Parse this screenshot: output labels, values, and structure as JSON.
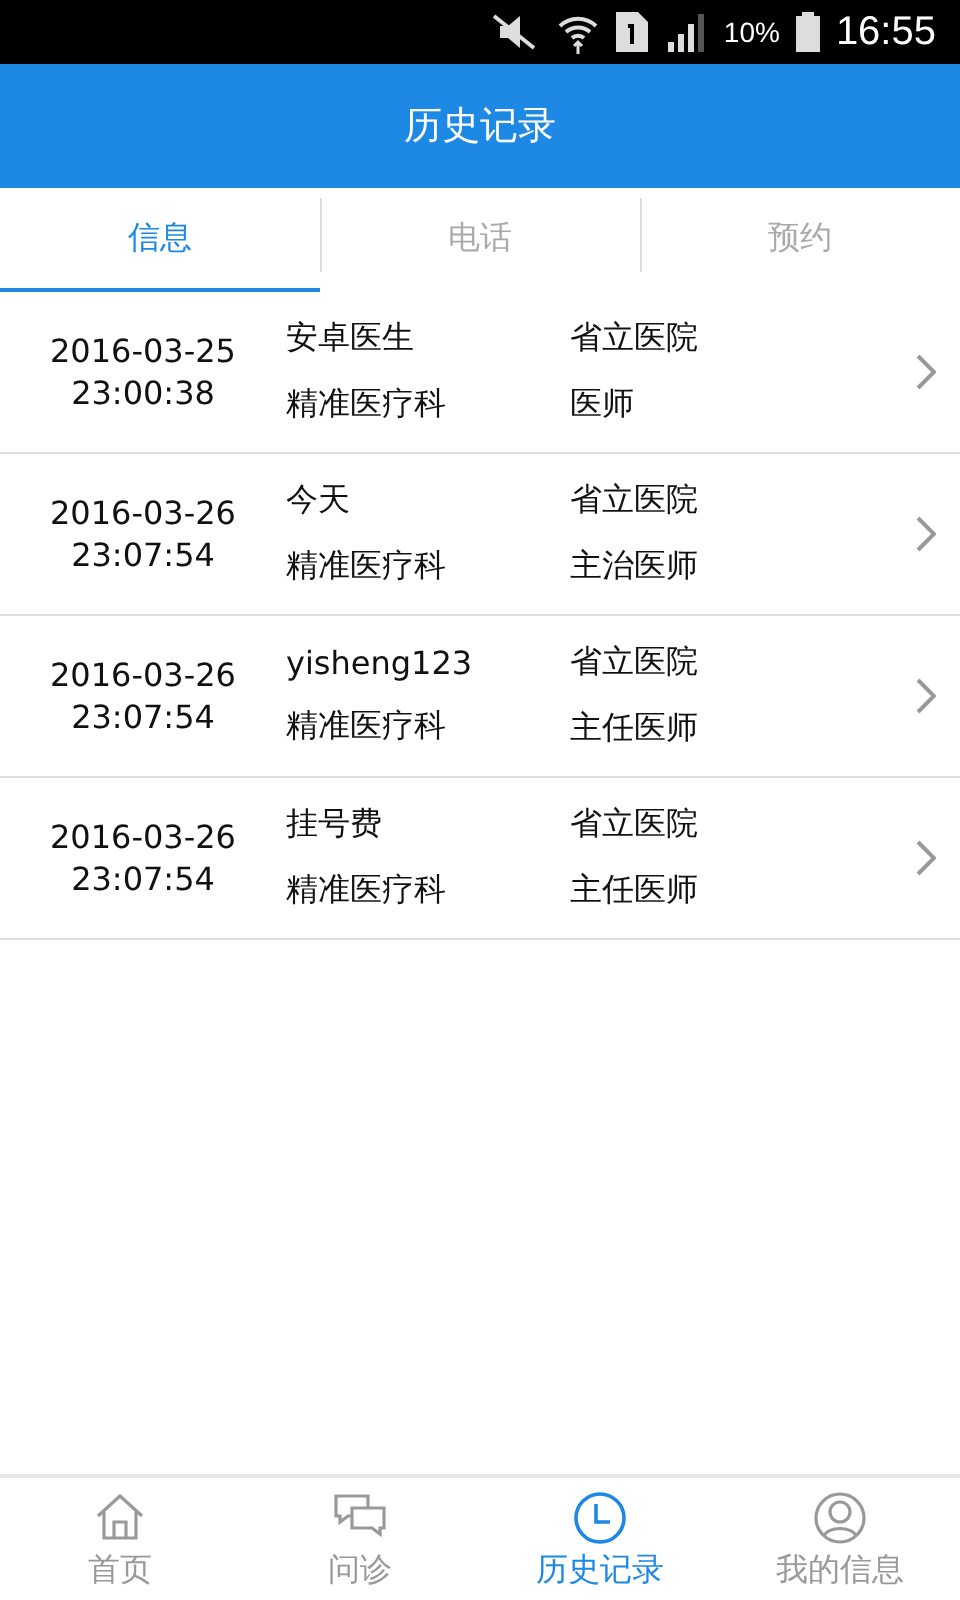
{
  "status_bar": {
    "battery": "10%",
    "time": "16:55"
  },
  "header": {
    "title": "历史记录"
  },
  "tabs": [
    {
      "label": "信息",
      "selected": true
    },
    {
      "label": "电话",
      "selected": false
    },
    {
      "label": "预约",
      "selected": false
    }
  ],
  "records": [
    {
      "date": "2016-03-25",
      "time": "23:00:38",
      "name": "安卓医生",
      "hospital": "省立医院",
      "department": "精准医疗科",
      "title": "医师"
    },
    {
      "date": "2016-03-26",
      "time": "23:07:54",
      "name": "今天",
      "hospital": "省立医院",
      "department": "精准医疗科",
      "title": "主治医师"
    },
    {
      "date": "2016-03-26",
      "time": "23:07:54",
      "name": "yisheng123",
      "hospital": "省立医院",
      "department": "精准医疗科",
      "title": "主任医师"
    },
    {
      "date": "2016-03-26",
      "time": "23:07:54",
      "name": "挂号费",
      "hospital": "省立医院",
      "department": "精准医疗科",
      "title": "主任医师"
    }
  ],
  "bottom_nav": [
    {
      "label": "首页",
      "kind": "home",
      "selected": false
    },
    {
      "label": "问诊",
      "kind": "chat",
      "selected": false
    },
    {
      "label": "历史记录",
      "kind": "clock",
      "selected": true
    },
    {
      "label": "我的信息",
      "kind": "user",
      "selected": false
    }
  ]
}
